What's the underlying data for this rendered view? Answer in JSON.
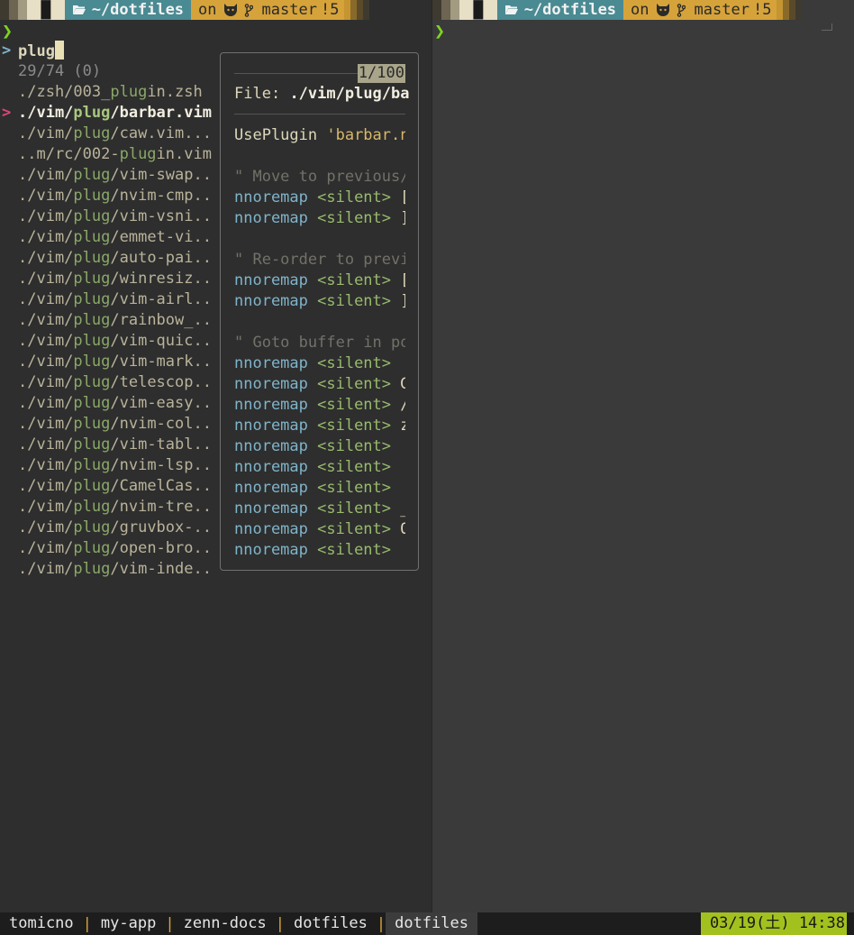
{
  "prompt": {
    "dir": "~/dotfiles",
    "on_label": "on",
    "branch": "master",
    "status": "!5",
    "arrow": "❯"
  },
  "finder": {
    "prompt_char": ">",
    "query": "plug",
    "count": "29/74 (0)",
    "selected_marker": ">",
    "items": [
      {
        "pre": "./zsh/003_",
        "hl": "plug",
        "post": "in.zsh"
      },
      {
        "pre": "./vim/",
        "hl": "plug",
        "post": "/barbar.vim",
        "selected": true
      },
      {
        "pre": "./vim/",
        "hl": "plug",
        "post": "/caw.vim..."
      },
      {
        "pre": "..m/rc/002-",
        "hl": "plug",
        "post": "in.vim"
      },
      {
        "pre": "./vim/",
        "hl": "plug",
        "post": "/vim-swap.."
      },
      {
        "pre": "./vim/",
        "hl": "plug",
        "post": "/nvim-cmp.."
      },
      {
        "pre": "./vim/",
        "hl": "plug",
        "post": "/vim-vsni.."
      },
      {
        "pre": "./vim/",
        "hl": "plug",
        "post": "/emmet-vi.."
      },
      {
        "pre": "./vim/",
        "hl": "plug",
        "post": "/auto-pai.."
      },
      {
        "pre": "./vim/",
        "hl": "plug",
        "post": "/winresiz.."
      },
      {
        "pre": "./vim/",
        "hl": "plug",
        "post": "/vim-airl.."
      },
      {
        "pre": "./vim/",
        "hl": "plug",
        "post": "/rainbow_.."
      },
      {
        "pre": "./vim/",
        "hl": "plug",
        "post": "/vim-quic.."
      },
      {
        "pre": "./vim/",
        "hl": "plug",
        "post": "/vim-mark.."
      },
      {
        "pre": "./vim/",
        "hl": "plug",
        "post": "/telescop.."
      },
      {
        "pre": "./vim/",
        "hl": "plug",
        "post": "/vim-easy.."
      },
      {
        "pre": "./vim/",
        "hl": "plug",
        "post": "/nvim-col.."
      },
      {
        "pre": "./vim/",
        "hl": "plug",
        "post": "/vim-tabl.."
      },
      {
        "pre": "./vim/",
        "hl": "plug",
        "post": "/nvim-lsp.."
      },
      {
        "pre": "./vim/",
        "hl": "plug",
        "post": "/CamelCas.."
      },
      {
        "pre": "./vim/",
        "hl": "plug",
        "post": "/nvim-tre.."
      },
      {
        "pre": "./vim/",
        "hl": "plug",
        "post": "/gruvbox-.."
      },
      {
        "pre": "./vim/",
        "hl": "plug",
        "post": "/open-bro.."
      },
      {
        "pre": "./vim/",
        "hl": "plug",
        "post": "/vim-inde.."
      }
    ]
  },
  "preview": {
    "counter": "1/100",
    "file_label": "File:",
    "file_path": "./vim/plug/ba",
    "lines": [
      {
        "type": "code",
        "parts": [
          [
            "plain",
            "UsePlugin "
          ],
          [
            "str",
            "'barbar.n"
          ]
        ]
      },
      {
        "type": "blank"
      },
      {
        "type": "code",
        "parts": [
          [
            "cmt",
            "\" Move to previous/"
          ]
        ]
      },
      {
        "type": "code",
        "parts": [
          [
            "kw",
            "nnoremap "
          ],
          [
            "sil",
            "<silent>"
          ],
          [
            "plain",
            " ["
          ]
        ]
      },
      {
        "type": "code",
        "parts": [
          [
            "kw",
            "nnoremap "
          ],
          [
            "sil",
            "<silent>"
          ],
          [
            "plain",
            " ]"
          ]
        ]
      },
      {
        "type": "blank"
      },
      {
        "type": "code",
        "parts": [
          [
            "cmt",
            "\" Re-order to previ"
          ]
        ]
      },
      {
        "type": "code",
        "parts": [
          [
            "kw",
            "nnoremap "
          ],
          [
            "sil",
            "<silent>"
          ],
          [
            "plain",
            " ["
          ]
        ]
      },
      {
        "type": "code",
        "parts": [
          [
            "kw",
            "nnoremap "
          ],
          [
            "sil",
            "<silent>"
          ],
          [
            "plain",
            " ]"
          ]
        ]
      },
      {
        "type": "blank"
      },
      {
        "type": "code",
        "parts": [
          [
            "cmt",
            "\" Goto buffer in po"
          ]
        ]
      },
      {
        "type": "code",
        "parts": [
          [
            "kw",
            "nnoremap "
          ],
          [
            "sil",
            "<silent>"
          ]
        ]
      },
      {
        "type": "code",
        "parts": [
          [
            "kw",
            "nnoremap "
          ],
          [
            "sil",
            "<silent>"
          ],
          [
            "plain",
            " G"
          ]
        ]
      },
      {
        "type": "code",
        "parts": [
          [
            "kw",
            "nnoremap "
          ],
          [
            "sil",
            "<silent>"
          ],
          [
            "plain",
            " /"
          ]
        ]
      },
      {
        "type": "code",
        "parts": [
          [
            "kw",
            "nnoremap "
          ],
          [
            "sil",
            "<silent>"
          ],
          [
            "plain",
            " z"
          ]
        ]
      },
      {
        "type": "code",
        "parts": [
          [
            "kw",
            "nnoremap "
          ],
          [
            "sil",
            "<silent>"
          ]
        ]
      },
      {
        "type": "code",
        "parts": [
          [
            "kw",
            "nnoremap "
          ],
          [
            "sil",
            "<silent>"
          ]
        ]
      },
      {
        "type": "code",
        "parts": [
          [
            "kw",
            "nnoremap "
          ],
          [
            "sil",
            "<silent>"
          ]
        ]
      },
      {
        "type": "code",
        "parts": [
          [
            "kw",
            "nnoremap "
          ],
          [
            "sil",
            "<silent>"
          ],
          [
            "plain",
            " _"
          ]
        ]
      },
      {
        "type": "code",
        "parts": [
          [
            "kw",
            "nnoremap "
          ],
          [
            "sil",
            "<silent>"
          ],
          [
            "plain",
            " O"
          ]
        ]
      },
      {
        "type": "code",
        "parts": [
          [
            "kw",
            "nnoremap "
          ],
          [
            "sil",
            "<silent>"
          ]
        ]
      }
    ]
  },
  "tmux": {
    "windows": [
      "tomicno",
      "my-app",
      "zenn-docs",
      "dotfiles",
      "dotfiles"
    ],
    "active_index": 4,
    "separator": "|",
    "clock": "03/19(土) 14:38"
  },
  "colors": {
    "prompt_arrow": "#7ed321",
    "dir_segment": "#4a8a92",
    "git_segment": "#d6a33a",
    "match_highlight": "#8aa868",
    "selected_marker": "#e0457b",
    "clock_bg": "#a2c11e"
  }
}
